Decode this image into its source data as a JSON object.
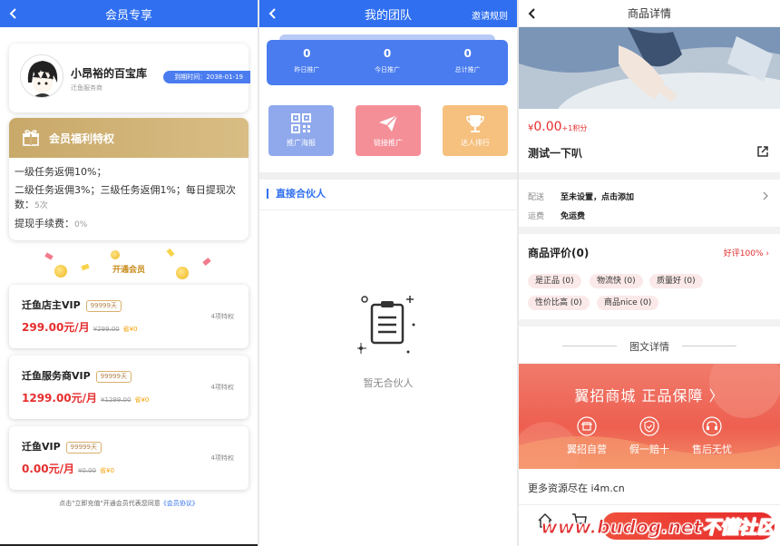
{
  "panel1": {
    "title": "会员专享",
    "user": {
      "name": "小昂裕的百宝库",
      "sub": "迁鱼服务商",
      "expire": "到期时间：2038-01-19"
    },
    "benefits": {
      "title": "会员福利特权",
      "line1": "一级任务返佣10%；",
      "line2": "二级任务返佣3%；三级任务返佣1%；每日提现次数：",
      "line2_value": "5次",
      "line3": "提现手续费：",
      "line3_value": "0%"
    },
    "open_vip": "开通会员",
    "vips": [
      {
        "name": "迁鱼店主VIP",
        "days": "99999天",
        "price": "299.00元/月",
        "orig": "¥299.00",
        "tk": "省¥0",
        "rights": "4项特权"
      },
      {
        "name": "迁鱼服务商VIP",
        "days": "99999天",
        "price": "1299.00元/月",
        "orig": "¥1299.00",
        "tk": "省¥0",
        "rights": "4项特权"
      },
      {
        "name": "迁鱼VIP",
        "days": "99999天",
        "price": "0.00元/月",
        "orig": "¥0.00",
        "tk": "省¥0",
        "rights": "4项特权"
      }
    ],
    "agree_text": "点击\"立即充值\"开通会员代表您同意",
    "agree_link": "《会员协议》"
  },
  "panel2": {
    "title": "我的团队",
    "invite_rule": "邀请规则",
    "stats": [
      {
        "num": "0",
        "label": "昨日推广"
      },
      {
        "num": "0",
        "label": "今日推广"
      },
      {
        "num": "0",
        "label": "总计推广"
      }
    ],
    "tools": [
      {
        "label": "推广海报",
        "color": "#8fa9ec",
        "icon": "qrcode-icon"
      },
      {
        "label": "链接推广",
        "color": "#f48f98",
        "icon": "paper-plane-icon"
      },
      {
        "label": "达人排行",
        "color": "#f6c07e",
        "icon": "trophy-icon"
      }
    ],
    "section": "直接合伙人",
    "empty": "暂无合伙人"
  },
  "panel3": {
    "title": "商品详情",
    "price_currency": "¥",
    "price": "0.00",
    "points": "+1积分",
    "goods_title": "测试一下叭",
    "ship_label": "配送",
    "ship_value": "至未设置，点击添加",
    "fee_label": "运费",
    "fee_value": "免运费",
    "review_title": "商品评价(0)",
    "good_rate": "好评100%",
    "tags": [
      "是正品 (0)",
      "物流快 (0)",
      "质量好 (0)",
      "性价比高 (0)",
      "商品nice (0)"
    ],
    "detail_title": "图文详情",
    "banner": {
      "title": "翼招商城 正品保障 〉",
      "items": [
        "翼招自营",
        "假一赔十",
        "售后无忧"
      ]
    },
    "more": "更多资源尽在 i4m.cn",
    "watermark": "www.budog.net不懂社区"
  }
}
